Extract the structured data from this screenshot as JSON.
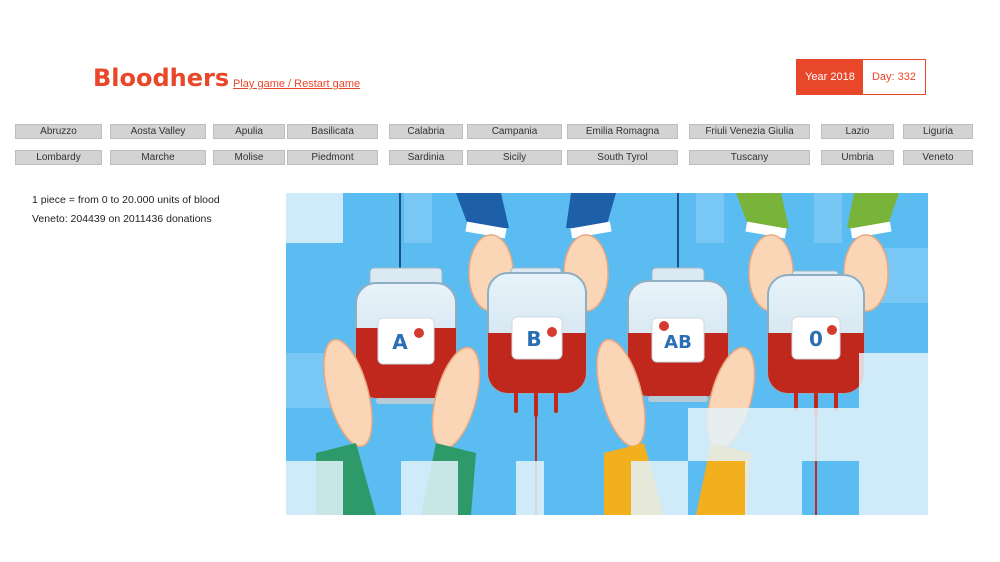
{
  "header": {
    "logo": "Bloodhers",
    "play_link": "Play game / Restart game",
    "year": "Year 2018",
    "day": "Day: 332"
  },
  "regions": [
    "Abruzzo",
    "Aosta Valley",
    "Apulia",
    "Basilicata",
    "Calabria",
    "Campania",
    "Emilia Romagna",
    "Friuli Venezia Giulia",
    "Lazio",
    "Liguria",
    "Lombardy",
    "Marche",
    "Molise",
    "Piedmont",
    "Sardinia",
    "Sicily",
    "South Tyrol",
    "Tuscany",
    "Umbria",
    "Veneto"
  ],
  "info": {
    "legend": "1 piece = from 0 to 20.000 units of blood",
    "stats": "Veneto: 204439 on 2011436 donations"
  },
  "puzzle": {
    "blood_types": [
      "A",
      "B",
      "AB",
      "0"
    ],
    "colors": {
      "sky": "#5bbcf2",
      "blood": "#c0281d",
      "tile": "#dff1fb"
    }
  }
}
